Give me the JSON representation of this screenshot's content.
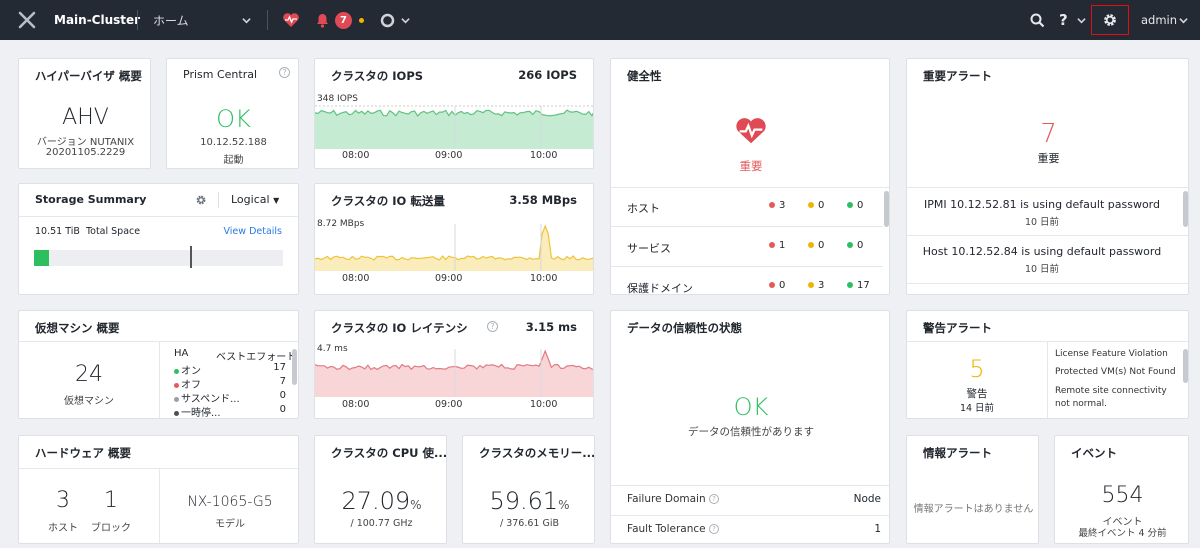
{
  "topbar": {
    "cluster": "Main-Cluster",
    "nav": "ホーム",
    "alert_count": "7",
    "user": "admin"
  },
  "hypervisor": {
    "title": "ハイパーバイザ 概要",
    "name": "AHV",
    "version_label": "バージョン NUTANIX",
    "version": "20201105.2229"
  },
  "prism": {
    "title": "Prism Central",
    "status": "OK",
    "ip": "10.12.52.188",
    "state": "起動"
  },
  "iops": {
    "title": "クラスタの IOPS",
    "value": "266 IOPS",
    "peak": "348 IOPS"
  },
  "io_bw": {
    "title": "クラスタの IO 転送量",
    "value": "3.58 MBps",
    "peak": "8.72 MBps"
  },
  "latency": {
    "title": "クラスタの IO レイテンシ",
    "value": "3.15 ms",
    "peak": "4.7 ms"
  },
  "time_ticks": [
    "08:00",
    "09:00",
    "10:00"
  ],
  "health": {
    "title": "健全性",
    "status": "重要",
    "rows": [
      {
        "label": "ホスト",
        "red": "3",
        "yellow": "0",
        "green": "0"
      },
      {
        "label": "サービス",
        "red": "1",
        "yellow": "0",
        "green": "0"
      },
      {
        "label": "保護ドメイン",
        "red": "0",
        "yellow": "3",
        "green": "17"
      }
    ]
  },
  "critical": {
    "title": "重要アラート",
    "count": "7",
    "label": "重要",
    "items": [
      {
        "text": "IPMI 10.12.52.81 is using default password",
        "time": "10 日前"
      },
      {
        "text": "Host 10.12.52.84 is using default password",
        "time": "10 日前"
      }
    ]
  },
  "storage": {
    "title": "Storage Summary",
    "mode": "Logical",
    "total_value": "10.51 TiB",
    "total_label": "Total Space",
    "details": "View Details",
    "used_fraction": 0.06
  },
  "vm": {
    "title": "仮想マシン 概要",
    "count": "24",
    "label": "仮想マシン",
    "col_ha": "HA",
    "col_best": "ベストエフォート",
    "rows": [
      {
        "label": "オン",
        "value": "17",
        "color": "#2dbe60"
      },
      {
        "label": "オフ",
        "value": "7",
        "color": "#e45a5a"
      },
      {
        "label": "サスペンド...",
        "value": "0",
        "color": "#9aa0a6"
      },
      {
        "label": "一時停...",
        "value": "0",
        "color": "#4a5058"
      }
    ]
  },
  "resiliency": {
    "title": "データの信頼性の状態",
    "status": "OK",
    "desc": "データの信頼性があります",
    "fd_label": "Failure Domain",
    "fd_value": "Node",
    "ft_label": "Fault Tolerance",
    "ft_value": "1"
  },
  "warning": {
    "title": "警告アラート",
    "count": "5",
    "label": "警告",
    "time": "14 日前",
    "items": [
      "License Feature Violation",
      "Protected VM(s) Not Found",
      "Remote site connectivity not normal."
    ]
  },
  "hardware": {
    "title": "ハードウェア 概要",
    "hosts": "3",
    "hosts_label": "ホスト",
    "blocks": "1",
    "blocks_label": "ブロック",
    "model": "NX-1065-G5",
    "model_label": "モデル"
  },
  "cpu": {
    "title": "クラスタの CPU 使...",
    "value": "27.09",
    "unit": "%",
    "sub": "/ 100.77 GHz"
  },
  "mem": {
    "title": "クラスタのメモリー...",
    "value": "59.61",
    "unit": "%",
    "sub": "/ 376.61 GiB"
  },
  "info": {
    "title": "情報アラート",
    "text": "情報アラートはありません"
  },
  "events": {
    "title": "イベント",
    "count": "554",
    "label": "イベント",
    "time": "最終イベント 4 分前"
  },
  "colors": {
    "green": "#2dbe60",
    "yellow": "#f0b400",
    "red": "#e45a5a",
    "highlight": "#e01010"
  }
}
